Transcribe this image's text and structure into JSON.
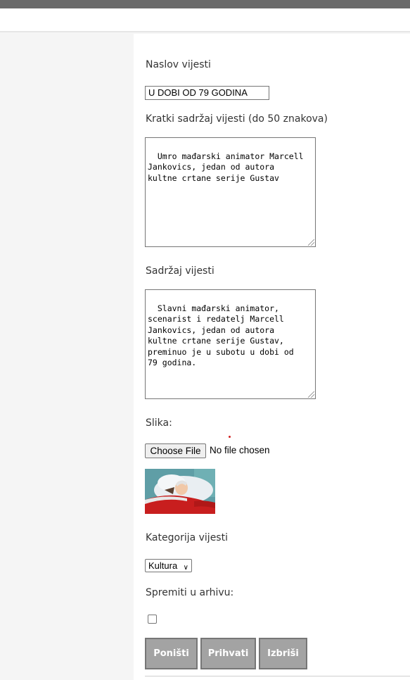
{
  "form": {
    "title_label": "Naslov vijesti",
    "title_value": "U DOBI OD 79 GODINA",
    "summary_label": "Kratki sadržaj vijesti (do 50 znakova)",
    "summary_value": "Umro mađarski animator Marcell\nJankovics, jedan od autora\nkultne crtane serije Gustav",
    "content_label": "Sadržaj vijesti",
    "content_value": "Slavni mađarski animator,\nscenarist i redatelj Marcell\nJankovics, jedan od autora\nkultne crtane serije Gustav,\npreminuo je u subotu u dobi od\n79 godina.",
    "image_label": "Slika:",
    "file_button": "Choose File",
    "file_status": "No file chosen",
    "category_label": "Kategorija vijesti",
    "category_selected": "Kultura",
    "archive_label": "Spremiti u arhivu:",
    "archive_checked": false
  },
  "buttons": {
    "reset": "Poništi",
    "accept": "Prihvati",
    "delete": "Izbriši"
  }
}
